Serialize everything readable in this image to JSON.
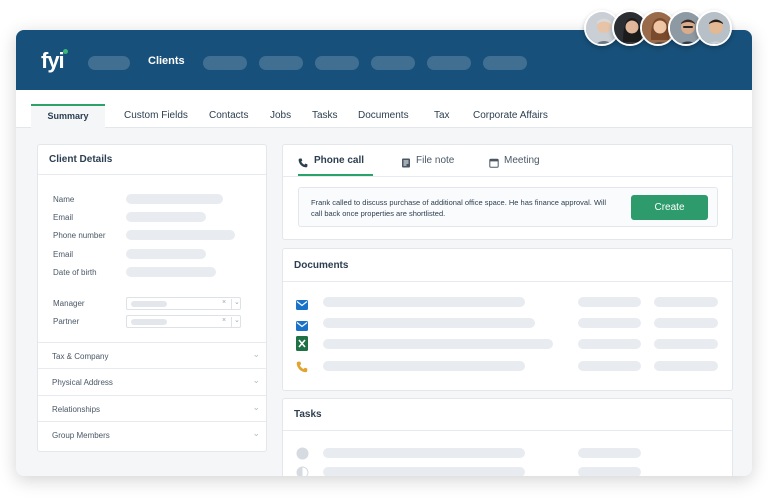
{
  "nav": {
    "active": "Clients"
  },
  "tabs": [
    "Summary",
    "Custom Fields",
    "Contacts",
    "Jobs",
    "Tasks",
    "Documents",
    "Tax",
    "Corporate Affairs"
  ],
  "client_details": {
    "title": "Client Details",
    "fields": [
      "Name",
      "Email",
      "Phone number",
      "Email",
      "Date of birth"
    ],
    "selects": [
      "Manager",
      "Partner"
    ],
    "sections": [
      "Tax & Company",
      "Physical Address",
      "Relationships",
      "Group Members"
    ]
  },
  "activity": {
    "tabs": [
      "Phone call",
      "File note",
      "Meeting"
    ],
    "note": "Frank called to discuss purchase of additional office space. He has finance approval. Will call back once properties are shortlisted.",
    "create_label": "Create"
  },
  "documents": {
    "title": "Documents",
    "icons": [
      "mail-icon",
      "mail-icon",
      "excel-icon",
      "phone-icon"
    ]
  },
  "tasks": {
    "title": "Tasks"
  },
  "colors": {
    "header": "#17507a",
    "accent": "#2aa36b",
    "button": "#2e9b6c",
    "mail_icon": "#1a73c8",
    "excel_icon": "#1e7145",
    "phone_icon": "#e0a42f"
  }
}
